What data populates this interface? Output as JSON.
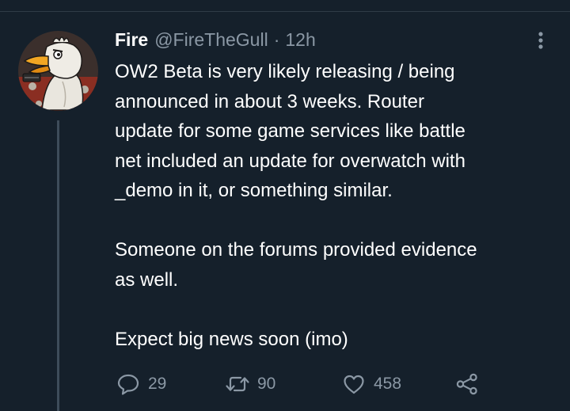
{
  "tweet": {
    "display_name": "Fire",
    "handle": "@FireTheGull",
    "separator": "·",
    "time": "12h",
    "text_lines": [
      "OW2 Beta is very likely releasing / being",
      "announced in about 3 weeks. Router",
      "update for some game services like battle",
      "net included an update for overwatch with",
      "_demo in it, or something similar.",
      "",
      "Someone on the forums provided evidence",
      "as well.",
      "",
      "Expect big news soon (imo)"
    ]
  },
  "actions": {
    "reply_count": "29",
    "retweet_count": "90",
    "like_count": "458"
  },
  "icons": {
    "reply": "speech-bubble-icon",
    "retweet": "retweet-arrows-icon",
    "like": "heart-outline-icon",
    "share": "share-nodes-icon",
    "more": "vertical-ellipsis-icon"
  },
  "colors": {
    "background": "#15202b",
    "primary_text": "#ffffff",
    "secondary_text": "#8b98a5",
    "thread_line": "#3e4c5a"
  }
}
